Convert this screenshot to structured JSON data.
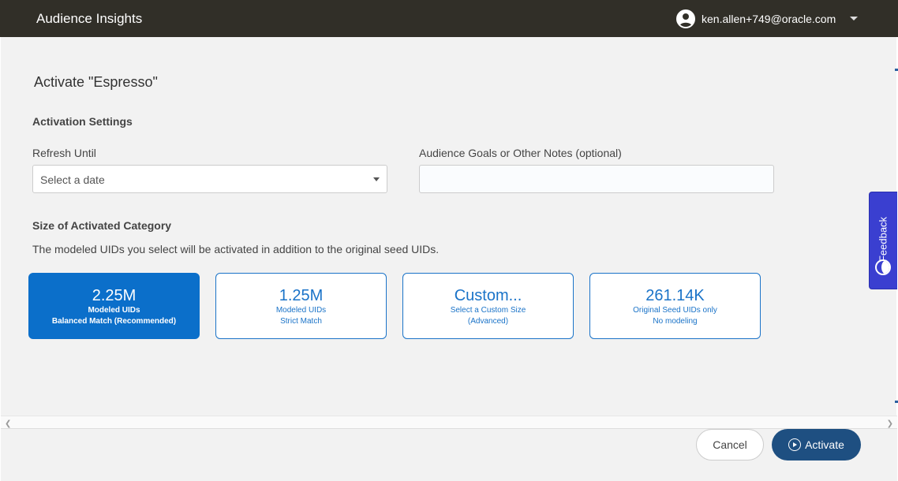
{
  "header": {
    "app_title": "Audience Insights",
    "user_email": "ken.allen+749@oracle.com"
  },
  "page": {
    "title": "Activate \"Espresso\"",
    "activation_settings_label": "Activation Settings",
    "refresh_until_label": "Refresh Until",
    "refresh_until_value": "Select a date",
    "notes_label": "Audience Goals or Other Notes (optional)",
    "notes_value": "",
    "size_section_label": "Size of Activated Category",
    "size_help_text": "The modeled UIDs you select will be activated in addition to the original seed UIDs."
  },
  "size_options": [
    {
      "value": "2.25M",
      "line1": "Modeled UIDs",
      "line2": "Balanced Match (Recommended)",
      "selected": true
    },
    {
      "value": "1.25M",
      "line1": "Modeled UIDs",
      "line2": "Strict Match",
      "selected": false
    },
    {
      "value": "Custom...",
      "line1": "Select a Custom Size",
      "line2": "(Advanced)",
      "selected": false
    },
    {
      "value": "261.14K",
      "line1": "Original Seed UIDs only",
      "line2": "No modeling",
      "selected": false
    }
  ],
  "footer": {
    "cancel_label": "Cancel",
    "activate_label": "Activate"
  },
  "feedback": {
    "label": "Feedback"
  },
  "colors": {
    "header_bg": "#312f28",
    "primary_blue": "#0b6fca",
    "activate_button": "#1e4f81",
    "feedback_tab": "#3a3fd0"
  }
}
